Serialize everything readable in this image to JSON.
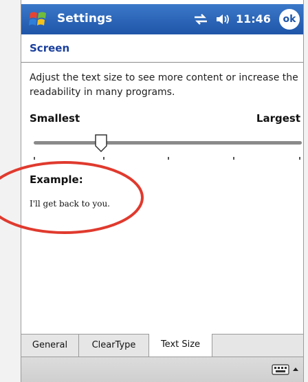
{
  "titlebar": {
    "title": "Settings",
    "time": "11:46",
    "ok_label": "ok"
  },
  "page": {
    "title": "Screen"
  },
  "description": "Adjust the text size to see more content or increase the readability in many programs.",
  "slider": {
    "min_label": "Smallest",
    "max_label": "Largest",
    "steps": 5,
    "selected_step": 1
  },
  "example": {
    "heading": "Example:",
    "text": "I'll get back to you."
  },
  "tabs": [
    {
      "label": "General",
      "active": false
    },
    {
      "label": "ClearType",
      "active": false
    },
    {
      "label": "Text Size",
      "active": true
    }
  ],
  "colors": {
    "titlebar": "#1f55a8",
    "page_title": "#1a3f9c",
    "highlight": "#e03a2e"
  },
  "icons": [
    "windows-start-icon",
    "connectivity-icon",
    "volume-icon",
    "keyboard-icon",
    "sip-arrow-icon"
  ]
}
